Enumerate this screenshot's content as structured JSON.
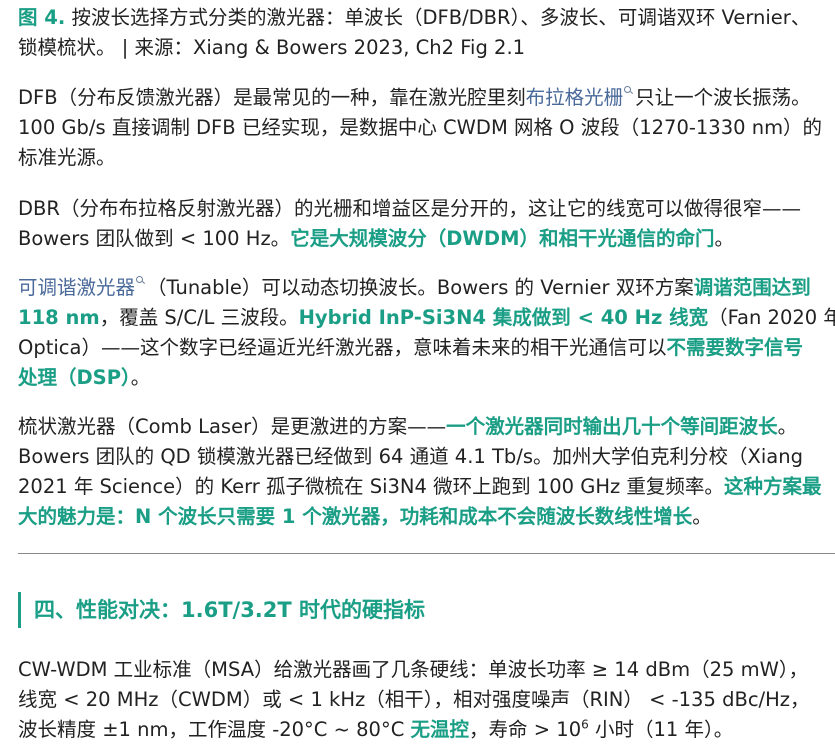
{
  "caption": {
    "label": "图 4.",
    "line1": " 按波长选择方式分类的激光器：单波长（DFB/DBR）、多波长、可调谐双环 Vernier、",
    "line2": "锁模梳状。 | 来源：Xiang & Bowers 2023, Ch2 Fig 2.1"
  },
  "p1": {
    "l1_a": "DFB（分布反馈激光器）是最常见的一种，靠在激光腔里刻",
    "l1_link": "布拉格光栅",
    "l1_b": "只让一个波长振荡。",
    "l2": "100 Gb/s 直接调制 DFB 已经实现，是数据中心 CWDM 网格 O 波段（1270-1330 nm）的",
    "l3": "标准光源。"
  },
  "p2": {
    "l1": "DBR（分布布拉格反射激光器）的光栅和增益区是分开的，这让它的线宽可以做得很窄——",
    "l2_a": "Bowers 团队做到 < 100 Hz。",
    "l2_hl": "它是大规模波分（DWDM）和相干光通信的命门",
    "l2_b": "。"
  },
  "p3": {
    "l1_link": "可调谐激光器",
    "l1_a": "（Tunable）可以动态切换波长。Bowers 的 Vernier 双环方案",
    "l1_hl": "调谐范围达到",
    "l2_hl1": "118 nm",
    "l2_a": "，覆盖 S/C/L 三波段。",
    "l2_hl2": "Hybrid InP-Si3N4 集成做到 < 40 Hz 线宽",
    "l2_b": "（Fan 2020 年",
    "l3_a": "Optica）——这个数字已经逼近光纤激光器，意味着未来的相干光通信可以",
    "l3_hl": "不需要数字信号",
    "l4_hl": "处理（DSP）",
    "l4_a": "。"
  },
  "p4": {
    "l1_a": "梳状激光器（Comb Laser）是更激进的方案——",
    "l1_hl": "一个激光器同时输出几十个等间距波长",
    "l1_b": "。",
    "l2": "Bowers 团队的 QD 锁模激光器已经做到 64 通道 4.1 Tb/s。加州大学伯克利分校（Xiang",
    "l3_a": "2021 年 Science）的 Kerr 孤子微梳在 Si3N4 微环上跑到 100 GHz 重复频率。",
    "l3_hl": "这种方案最",
    "l4_hl": "大的魅力是：N 个波长只需要 1 个激光器，功耗和成本不会随波长数线性增长",
    "l4_a": "。"
  },
  "section": {
    "title": "四、性能对决：1.6T/3.2T 时代的硬指标"
  },
  "p5": {
    "l1": "CW-WDM 工业标准（MSA）给激光器画了几条硬线：单波长功率 ≥ 14 dBm（25 mW），",
    "l2": "线宽 < 20 MHz（CWDM）或 < 1 kHz（相干），相对强度噪声（RIN） < -135 dBc/Hz，",
    "l3_a": "波长精度 ±1 nm，工作温度 -20°C ~ 80°C ",
    "l3_hl": "无温控",
    "l3_b": "，寿命 > 10",
    "l3_sup": "6",
    "l3_c": " 小时（11 年）。"
  },
  "colors": {
    "accent": "#1a9e85",
    "link": "#4a6a9a",
    "text": "#222222",
    "divider": "#8a8a8a"
  },
  "icons": {
    "link_marker": "search-icon"
  }
}
